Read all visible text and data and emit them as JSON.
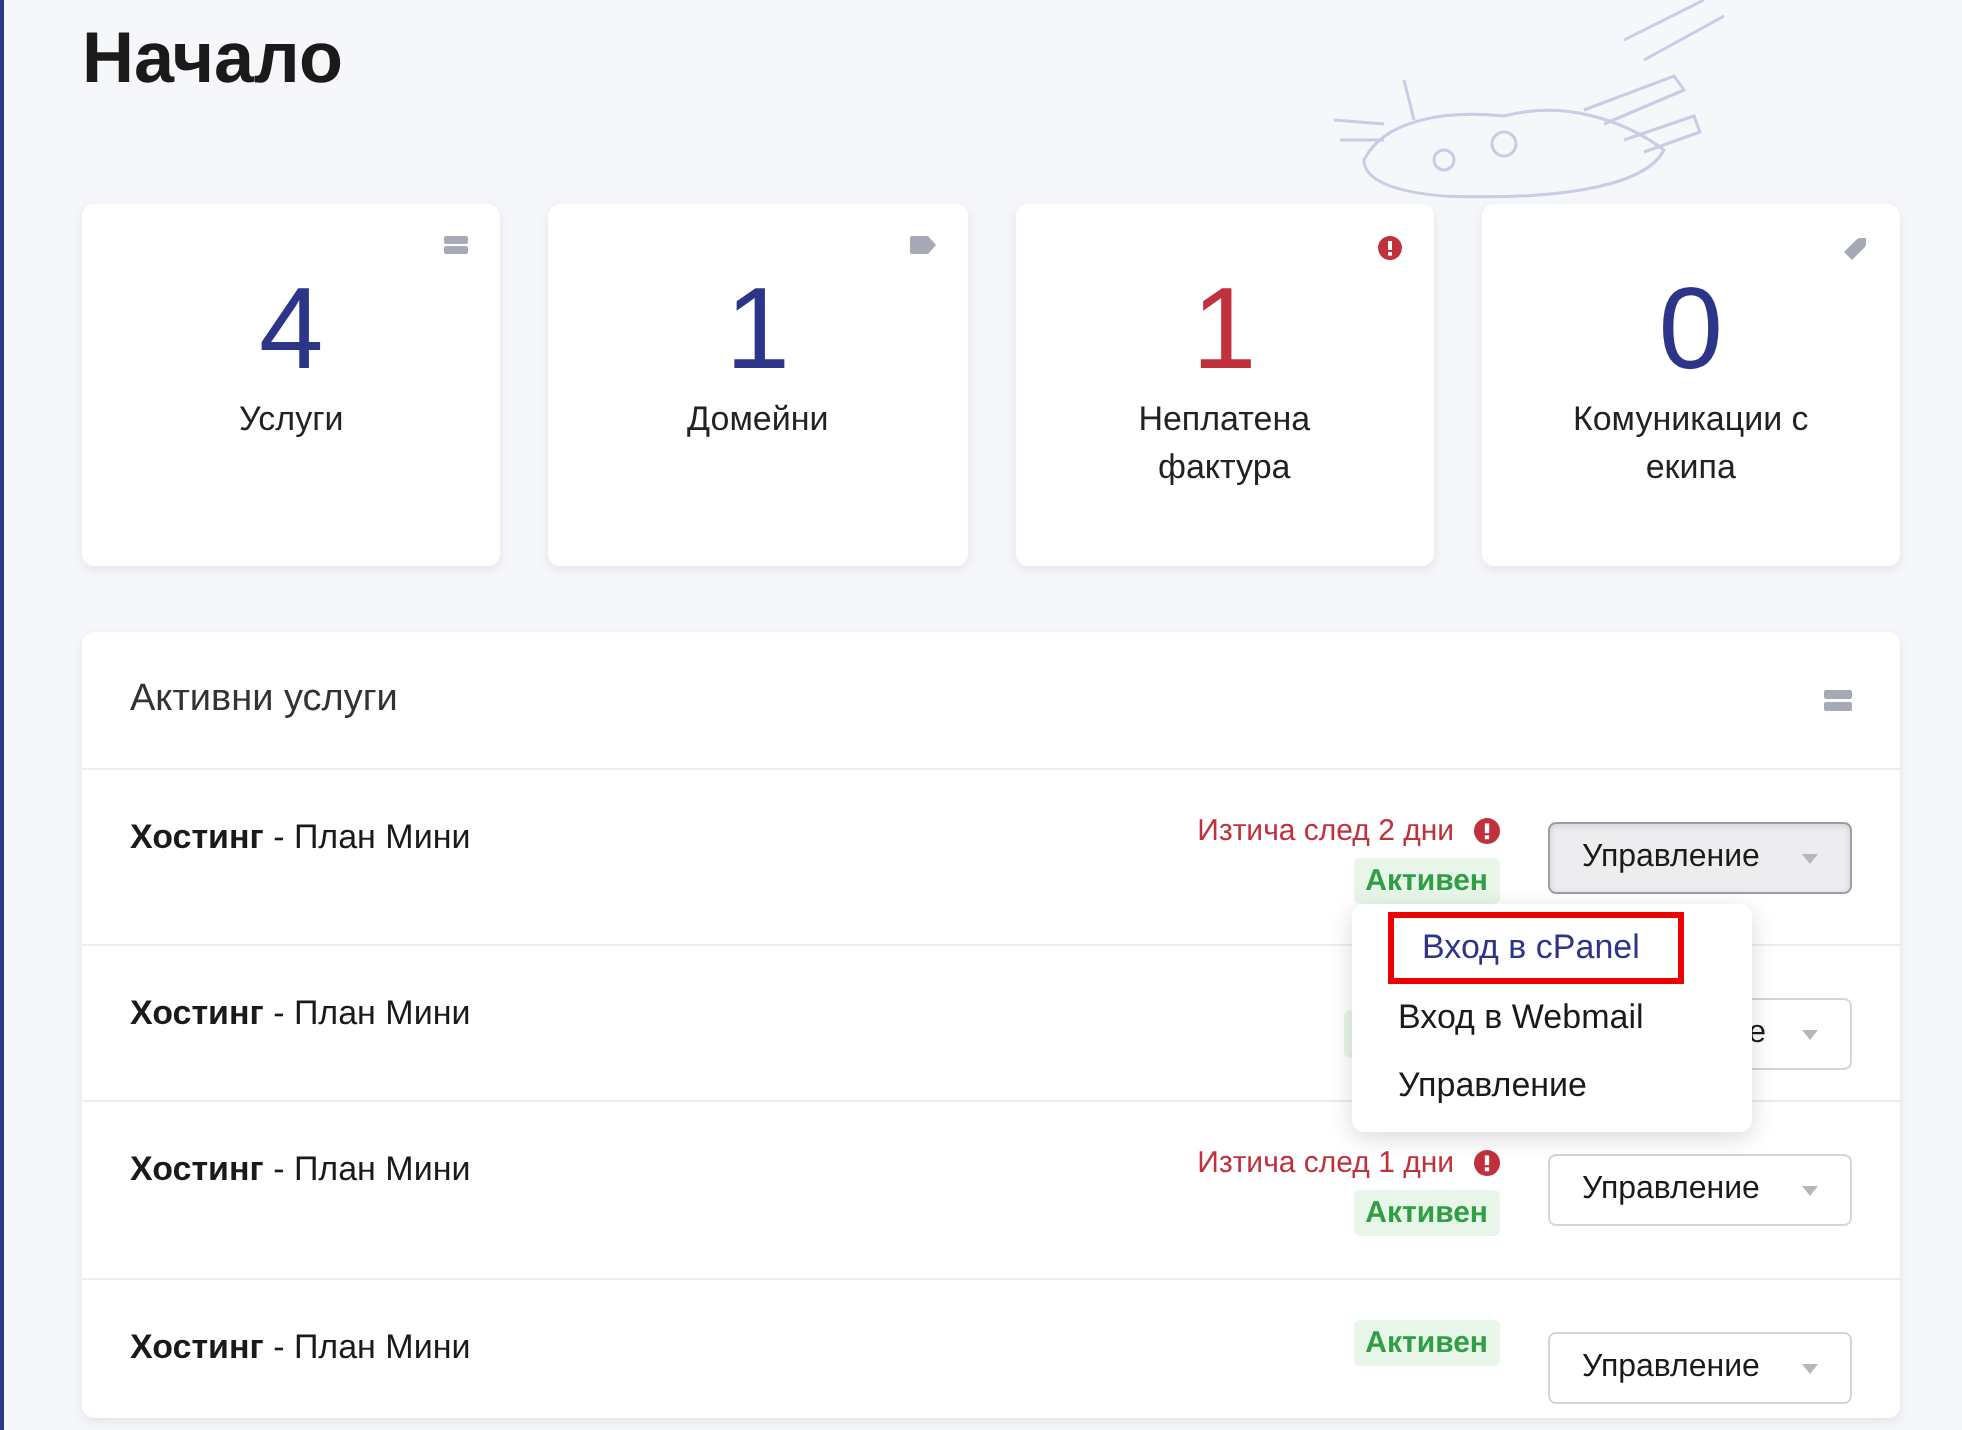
{
  "page": {
    "title": "Начало"
  },
  "cards": [
    {
      "value": "4",
      "label": "Услуги",
      "kind": "server",
      "alert": false
    },
    {
      "value": "1",
      "label": "Домейни",
      "kind": "tag",
      "alert": false
    },
    {
      "value": "1",
      "label": "Неплатена фактура",
      "kind": "alert",
      "alert": true
    },
    {
      "value": "0",
      "label": "Комуникации с екипа",
      "kind": "tag-tilted",
      "alert": false
    }
  ],
  "services": {
    "title": "Активни услуги",
    "rows": [
      {
        "name": "**Хостинг** - План Мини",
        "expiry": "Изтича след 2 дни",
        "status": "Активен",
        "button": "Управление",
        "menu_open": true,
        "menu": [
          {
            "label": "Вход в cPanel",
            "highlighted": true
          },
          {
            "label": "Вход в Webmail",
            "highlighted": false
          },
          {
            "label": "Управление",
            "highlighted": false
          }
        ]
      },
      {
        "name": "**Хостинг** - План Мини",
        "status_covered": true,
        "button": "е",
        "menu_open": false
      },
      {
        "name": "**Хостинг** - План Мини",
        "expiry": "Изтича след 1 дни",
        "status": "Активен",
        "button": "Управление",
        "menu_open": false
      },
      {
        "name": "**Хостинг** - План Мини",
        "status": "Активен",
        "button": "Управление",
        "menu_open": false
      }
    ]
  }
}
